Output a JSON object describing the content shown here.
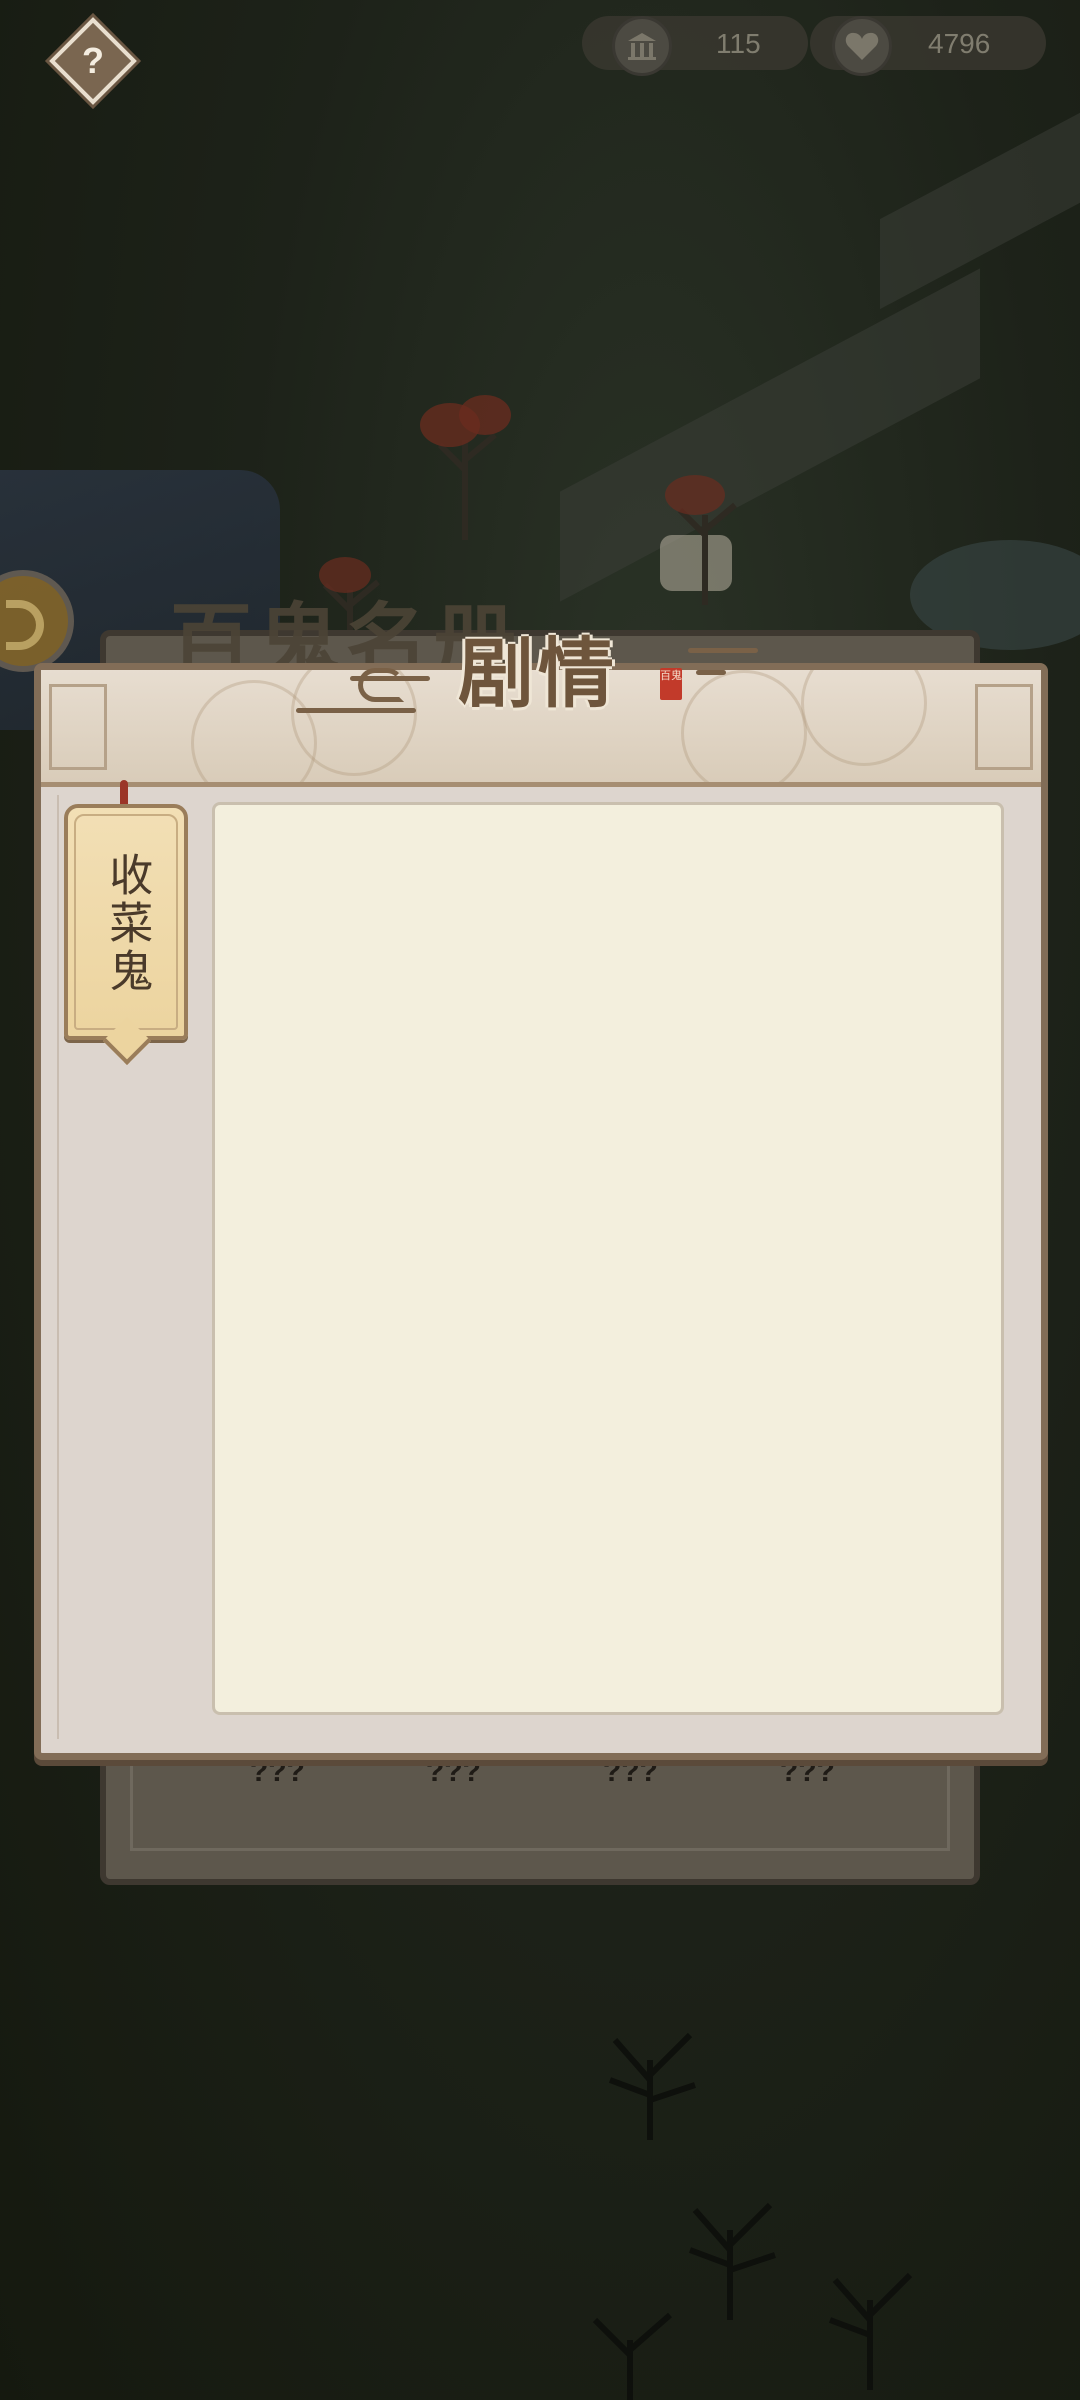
{
  "top_bar": {
    "temple_icon": "temple-icon",
    "temple_count": "115",
    "heart_icon": "heart-icon",
    "heart_count": "4796"
  },
  "background_panel": {
    "title": "百鬼名册",
    "row_labels": [
      "???",
      "???",
      "???",
      "???"
    ]
  },
  "dialog": {
    "title": "剧情",
    "seal_text": "百鬼",
    "help_icon": "question-mark-icon",
    "help_glyph": "?",
    "chapter_tab": {
      "label": "收菜鬼"
    },
    "content_text": ""
  },
  "colors": {
    "frame": "#826d57",
    "panel": "#ddd5ce",
    "content": "#f3efdd",
    "title": "#6e553c",
    "tab": "#ecd49f",
    "seal": "#c23a2a"
  }
}
